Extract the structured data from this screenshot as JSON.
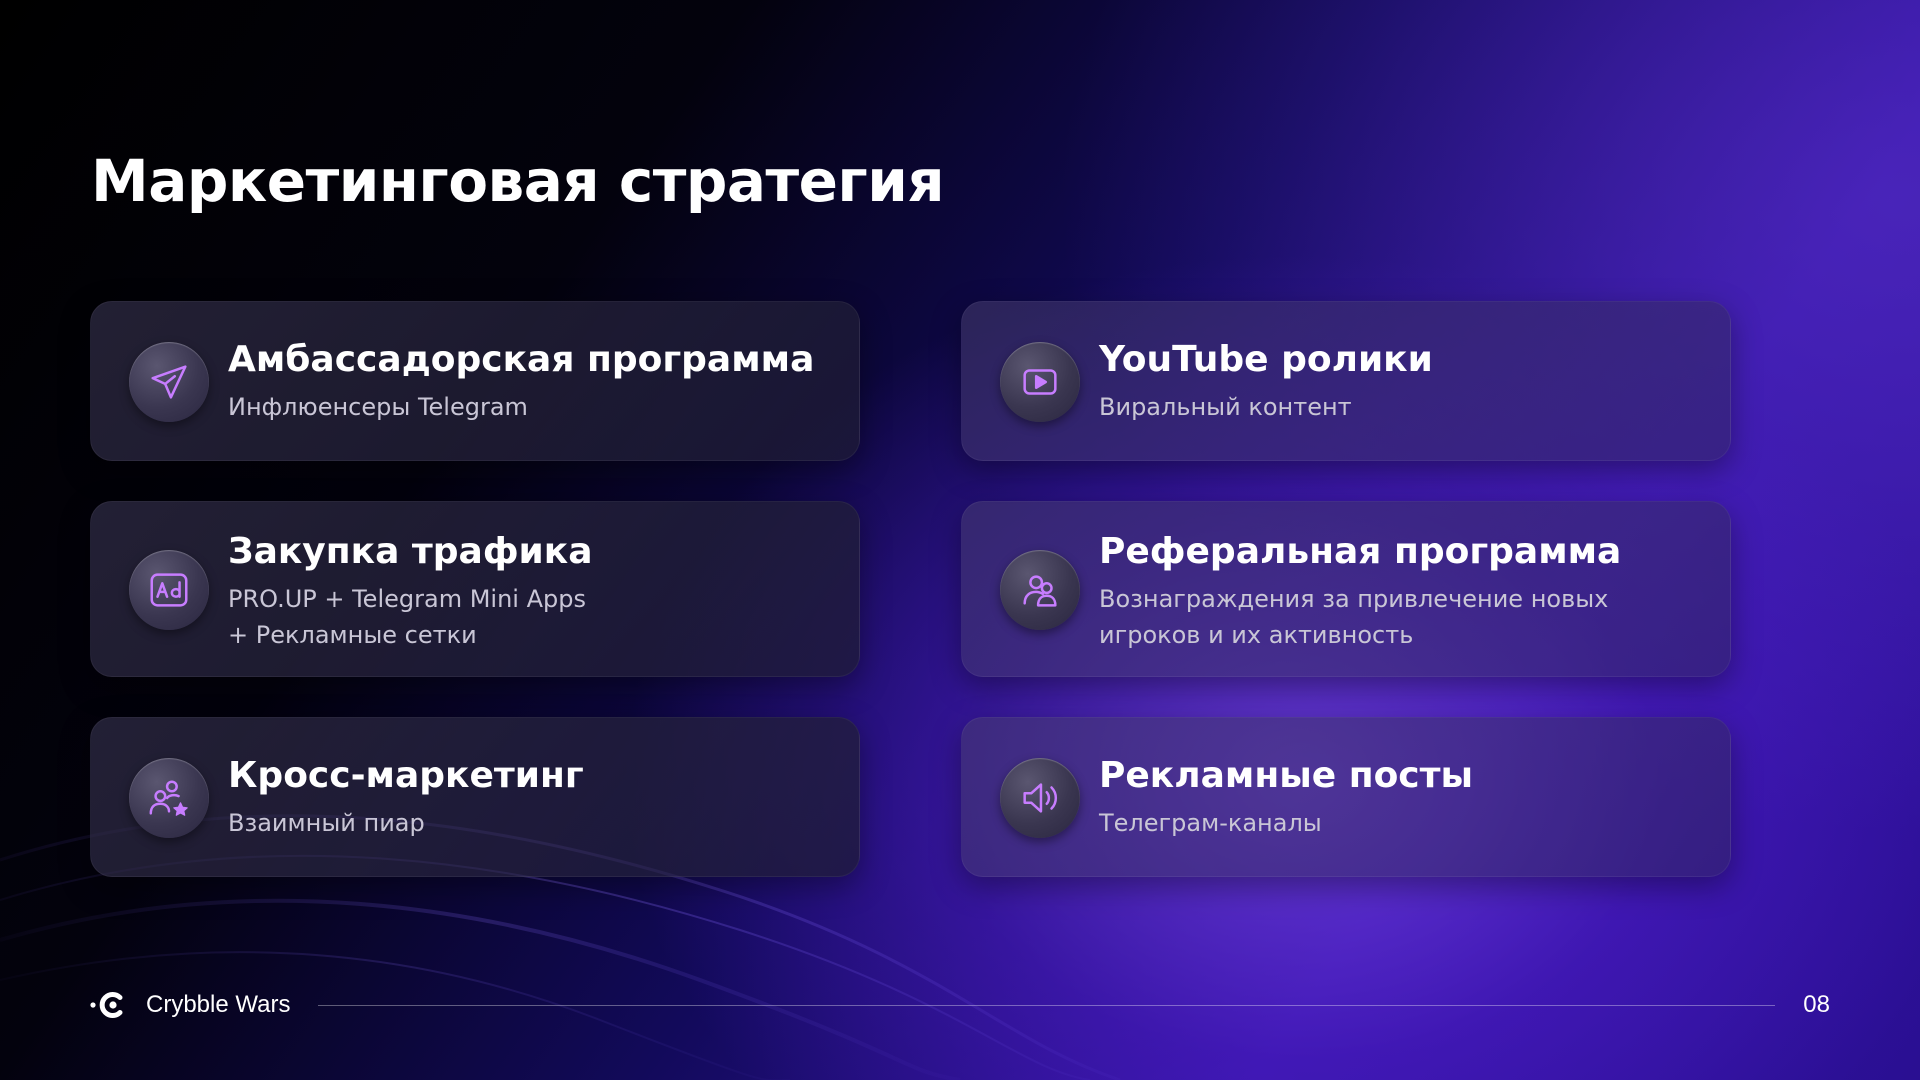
{
  "slide": {
    "title": "Маркетинговая стратегия"
  },
  "cards": [
    {
      "title": "Амбассадорская программа",
      "lines": [
        "Инфлюенсеры Telegram"
      ],
      "icon": "paper-plane-icon"
    },
    {
      "title": "YouTube ролики",
      "lines": [
        "Виральный контент"
      ],
      "icon": "video-play-icon"
    },
    {
      "title": "Закупка трафика",
      "lines": [
        "PRO.UP + Telegram Mini Apps",
        "+ Рекламные сетки"
      ],
      "icon": "ad-icon"
    },
    {
      "title": "Реферальная программа",
      "lines": [
        "Вознаграждения за привлечение новых",
        "игроков и их активность"
      ],
      "icon": "users-icon"
    },
    {
      "title": "Кросс-маркетинг",
      "lines": [
        "Взаимный пиар"
      ],
      "icon": "users-star-icon"
    },
    {
      "title": "Рекламные посты",
      "lines": [
        "Телеграм-каналы"
      ],
      "icon": "speaker-icon"
    }
  ],
  "footer": {
    "brand": "Crybble Wars",
    "page_number": "08"
  },
  "colors": {
    "icon_accent": "#c77dff",
    "text_secondary": "#c9c6d6",
    "background_accent": "#3413a8"
  }
}
